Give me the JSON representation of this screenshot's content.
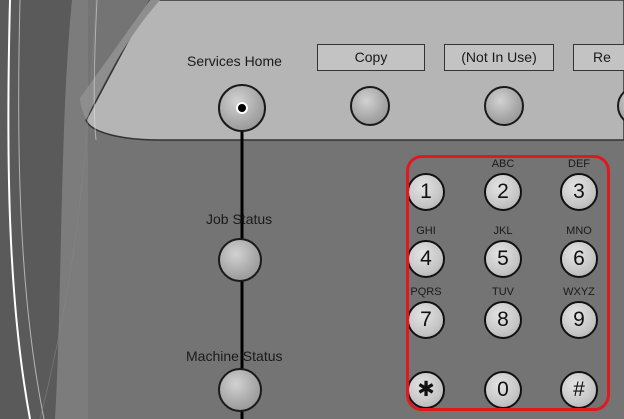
{
  "panel": {
    "services_home_label": "Services Home",
    "job_status_label": "Job Status",
    "machine_status_label": "Machine Status"
  },
  "mode_buttons": [
    {
      "label": "Copy"
    },
    {
      "label": "(Not In Use)"
    },
    {
      "label": "Re"
    }
  ],
  "keypad": {
    "keys": [
      {
        "digit": "1",
        "letters": ""
      },
      {
        "digit": "2",
        "letters": "ABC"
      },
      {
        "digit": "3",
        "letters": "DEF"
      },
      {
        "digit": "4",
        "letters": "GHI"
      },
      {
        "digit": "5",
        "letters": "JKL"
      },
      {
        "digit": "6",
        "letters": "MNO"
      },
      {
        "digit": "7",
        "letters": "PQRS"
      },
      {
        "digit": "8",
        "letters": "TUV"
      },
      {
        "digit": "9",
        "letters": "WXYZ"
      },
      {
        "digit": "✱",
        "letters": ""
      },
      {
        "digit": "0",
        "letters": ""
      },
      {
        "digit": "#",
        "letters": ""
      }
    ],
    "highlight_color": "#e0191e"
  },
  "callout": {
    "target": "services-home-button",
    "color": "#000000"
  }
}
